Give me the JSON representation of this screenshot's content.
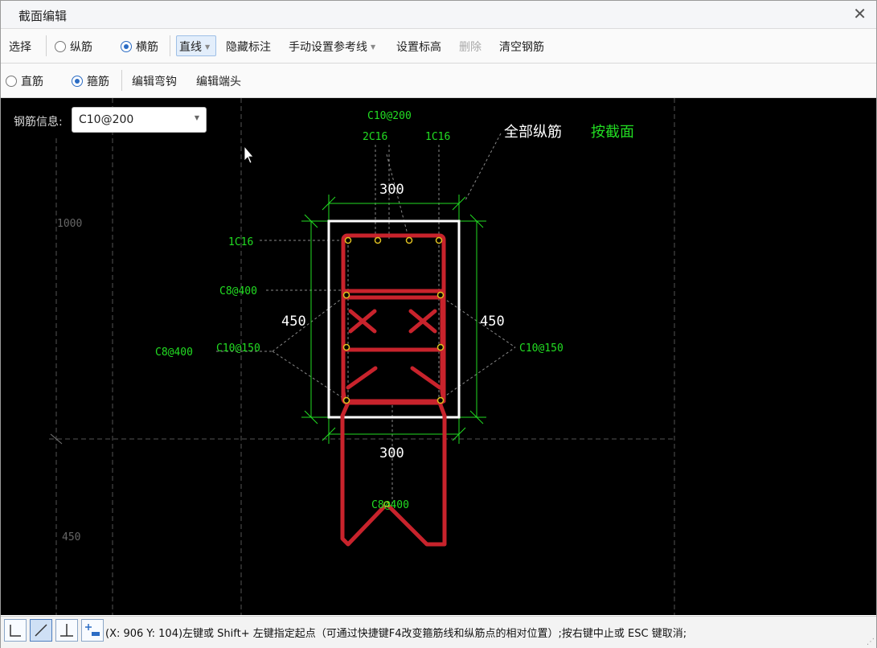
{
  "window": {
    "title": "截面编辑",
    "close_glyph": "✕"
  },
  "toolbar1": {
    "select_label": "选择",
    "longitudinal_label": "纵筋",
    "transverse_label": "横筋",
    "line_label": "直线",
    "hide_annotation_label": "隐藏标注",
    "manual_ref_label": "手动设置参考线",
    "set_elevation_label": "设置标高",
    "delete_label": "删除",
    "clear_rebar_label": "清空钢筋",
    "selected_mode": "横筋"
  },
  "toolbar2": {
    "straight_label": "直筋",
    "stirrup_label": "箍筋",
    "edit_hook_label": "编辑弯钩",
    "edit_end_label": "编辑端头",
    "selected_mode": "箍筋"
  },
  "rebar_info": {
    "label": "钢筋信息:",
    "value": "C10@200"
  },
  "drawing": {
    "labels": {
      "top_stirrup": "C10@200",
      "top_left_rebar": "2C16",
      "top_right_rebar": "1C16",
      "all_longitudinal": "全部纵筋",
      "by_section": "按截面",
      "left_corner_rebar": "1C16",
      "tie_upper": "C8@400",
      "tie_left": "C8@400",
      "stirrup_left": "C10@150",
      "stirrup_right": "C10@150",
      "bottom_tie": "C8@400",
      "dim_top": "300",
      "dim_bottom": "300",
      "dim_left": "450",
      "dim_right": "450",
      "grid_label_1000": "1000",
      "grid_label_450": "450"
    },
    "colors": {
      "rebar": "#c8232c",
      "annotation": "#22dd22",
      "outline": "#ffffff",
      "point": "#e0c020"
    }
  },
  "statusbar": {
    "text": "(X: 906 Y: 104)左键或 Shift+ 左键指定起点（可通过快捷键F4改变箍筋线和纵筋点的相对位置）;按右键中止或 ESC 键取消;",
    "buttons": [
      "ortho-icon",
      "line-icon",
      "perpendicular-icon",
      "add-point-icon"
    ]
  }
}
